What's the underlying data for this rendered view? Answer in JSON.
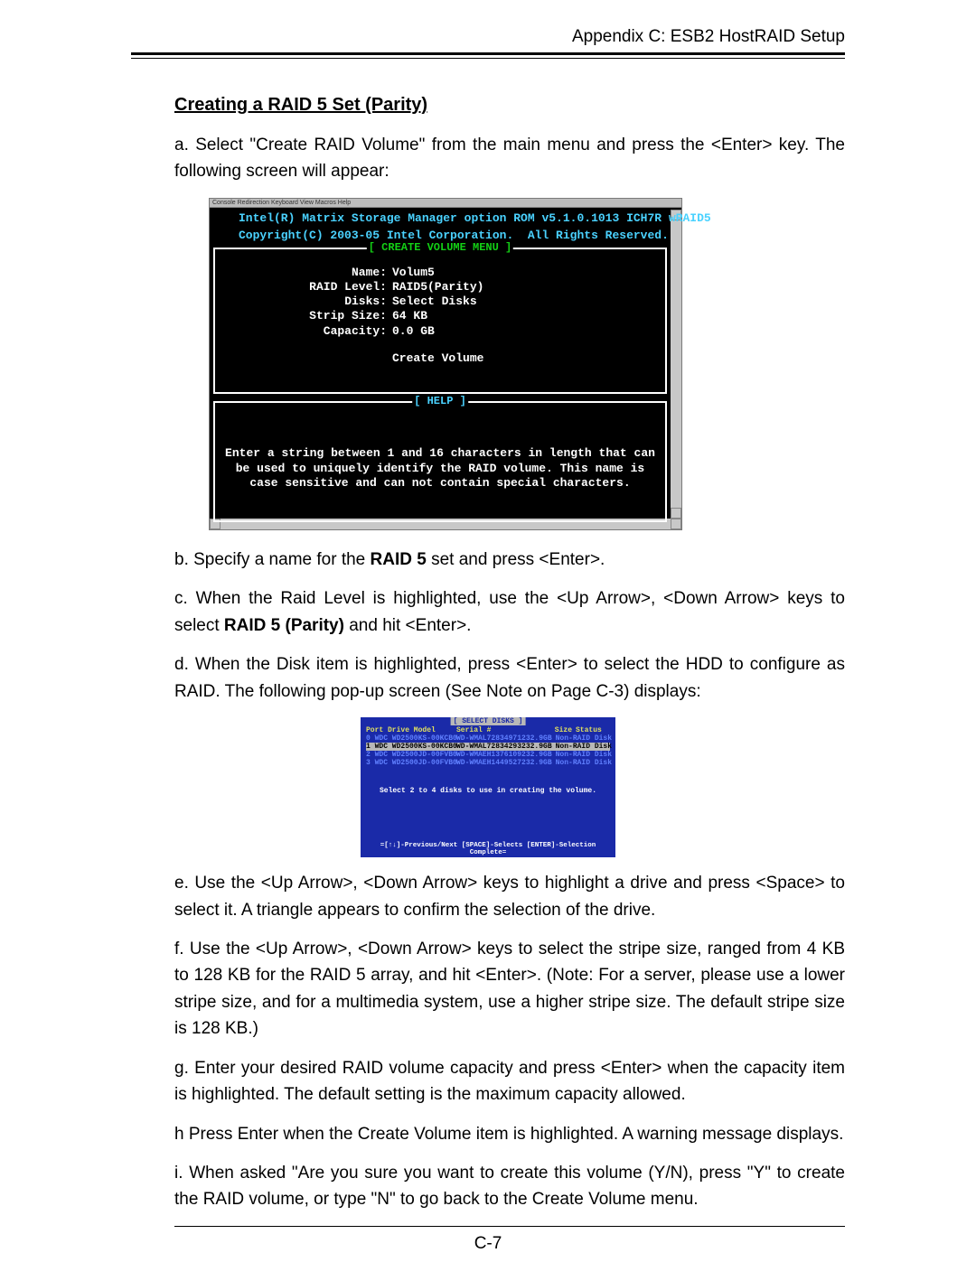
{
  "header": {
    "appendix": "Appendix C: ESB2 HostRAID Setup"
  },
  "title": "Creating a RAID 5 Set (Parity)",
  "paragraphs": {
    "a1": "a. Select \"Create RAID Volume\" from the main menu and press the <Enter> key. The following screen will appear:",
    "b_pre": "b. Specify a name for the ",
    "b_bold": "RAID 5",
    "b_post": " set and press <Enter>.",
    "c_pre": "c. When the Raid Level is highlighted, use the <Up Arrow>, <Down Arrow> keys to select  ",
    "c_bold": "RAID 5 (Parity)",
    "c_post": " and hit <Enter>.",
    "d": "d. When the Disk item is highlighted, press <Enter> to select the HDD to configure as RAID.  The following pop-up screen (See Note on Page C-3) displays:",
    "e": "e. Use  the <Up Arrow>, <Down Arrow> keys to highlight a drive and press <Space> to select it. A triangle appears to confirm the selection of the drive.",
    "f": "f. Use  the <Up Arrow>, <Down Arrow> keys to select the stripe size, ranged from 4 KB to 128 KB for the RAID 5 array, and hit <Enter>. (Note: For a server, please use a lower stripe size, and for a multimedia system, use a higher stripe size. The default stripe size is 128 KB.)",
    "g": "g. Enter your desired RAID volume capacity and press <Enter> when the capacity item is highlighted. The default setting is the maximum capacity allowed.",
    "h": "h  Press Enter when the Create Volume item is highlighted. A warning message displays.",
    "i": "i. When asked \"Are you sure you want to create this volume (Y/N), press \"Y\" to create the RAID volume, or type \"N\" to go back to the Create Volume menu."
  },
  "console": {
    "menubar": "Console Redirection   Keyboard   View   Macros   Help",
    "rom1": "Intel(R) Matrix Storage Manager option ROM v5.1.0.1013 ICH7R wRAID5",
    "rom2": "Copyright(C) 2003-05 Intel Corporation.  All Rights Reserved.",
    "menu_title": "[ CREATE VOLUME MENU ]",
    "help_title": "[ HELP ]",
    "form": {
      "name_l": "Name:",
      "name_v": "Volum5",
      "level_l": "RAID Level:",
      "level_v": "RAID5(Parity)",
      "disks_l": "Disks:",
      "disks_v": "Select Disks",
      "strip_l": "Strip Size:",
      "strip_v": "64 KB",
      "cap_l": "Capacity:",
      "cap_v": "0.0   GB",
      "create": "Create Volume"
    },
    "help_text": "Enter a string between 1 and 16 characters in length that can be used to uniquely identify the RAID volume. This name is case sensitive and can not contain special characters."
  },
  "popup": {
    "title": "[ SELECT DISKS ]",
    "head": {
      "c1": "Port Drive Model",
      "c2": "Serial #",
      "c3": "Size",
      "c4": "Status"
    },
    "rows": [
      {
        "c1": "0 WDC WD2500KS-00KCB0",
        "c2": "WD-WMAL72834971",
        "c3": "232.9GB",
        "c4": "Non-RAID Disk",
        "sel": false
      },
      {
        "c1": "1 WDC WD2500KS-00KCB0",
        "c2": "WD-WMAL72834293",
        "c3": "232.9GB",
        "c4": "Non-RAID Disk",
        "sel": true
      },
      {
        "c1": "2 WDC WD2500JD-00FVB0",
        "c2": "WD-WMAEH1376109",
        "c3": "232.9GB",
        "c4": "Non-RAID Disk",
        "sel": false
      },
      {
        "c1": "3 WDC WD2500JD-00FVB0",
        "c2": "WD-WMAEH1449527",
        "c3": "232.9GB",
        "c4": "Non-RAID Disk",
        "sel": false
      }
    ],
    "msg": "Select 2 to 4 disks to use in creating the volume.",
    "footer": "=[↑↓]-Previous/Next  [SPACE]-Selects  [ENTER]-Selection Complete="
  },
  "page_num": "C-7"
}
